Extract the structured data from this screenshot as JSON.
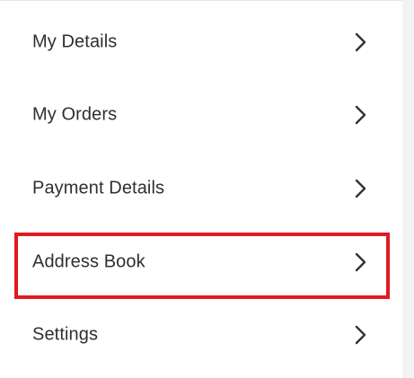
{
  "menu": {
    "items": [
      {
        "label": "My Details",
        "icon": "chevron-right-icon"
      },
      {
        "label": "My Orders",
        "icon": "chevron-right-icon"
      },
      {
        "label": "Payment Details",
        "icon": "chevron-right-icon"
      },
      {
        "label": "Address Book",
        "icon": "chevron-right-icon",
        "highlighted": true
      },
      {
        "label": "Settings",
        "icon": "chevron-right-icon"
      }
    ]
  },
  "colors": {
    "text": "#2f2f2f",
    "highlight": "#e2191f",
    "background": "#ffffff"
  }
}
